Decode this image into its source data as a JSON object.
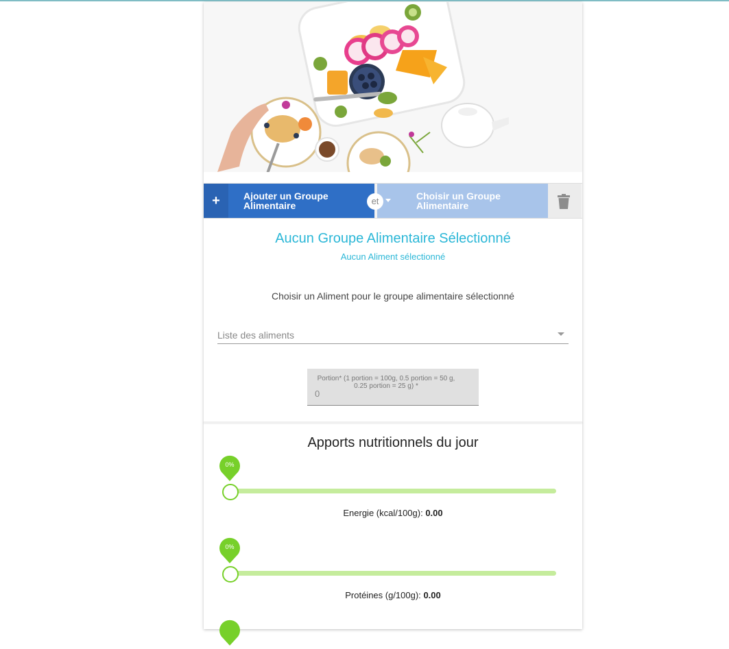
{
  "buttons": {
    "add_group": "Ajouter un Groupe Alimentaire",
    "plus": "+",
    "et": "et",
    "choose_group": "Choisir un Groupe Alimentaire"
  },
  "selection": {
    "group_title": "Aucun Groupe Alimentaire Sélectionné",
    "food_subtitle": "Aucun Aliment sélectionné",
    "prompt": "Choisir un Aliment pour le groupe alimentaire sélectionné"
  },
  "food_select": {
    "placeholder": "Liste des aliments"
  },
  "portion_field": {
    "label": "Portion* (1 portion = 100g, 0.5 portion = 50 g, 0.25 portion = 25 g) *",
    "value": "0"
  },
  "nutrition": {
    "title": "Apports nutritionnels du jour",
    "items": [
      {
        "label": "Energie (kcal/100g):",
        "value": "0.00",
        "percent_label": "0%",
        "level": 0
      },
      {
        "label": "Protéines (g/100g):",
        "value": "0.00",
        "percent_label": "0%",
        "level": 0
      }
    ]
  },
  "colors": {
    "primary_button": "#2f6fc6",
    "secondary_button": "#a8c4ea",
    "heading_accent": "#2bb7d7",
    "slider_green": "#77d02a",
    "slider_track": "#c5ec9c"
  },
  "icons": {
    "add": "plus-icon",
    "dropdown": "caret-down-icon",
    "delete": "trash-icon"
  }
}
